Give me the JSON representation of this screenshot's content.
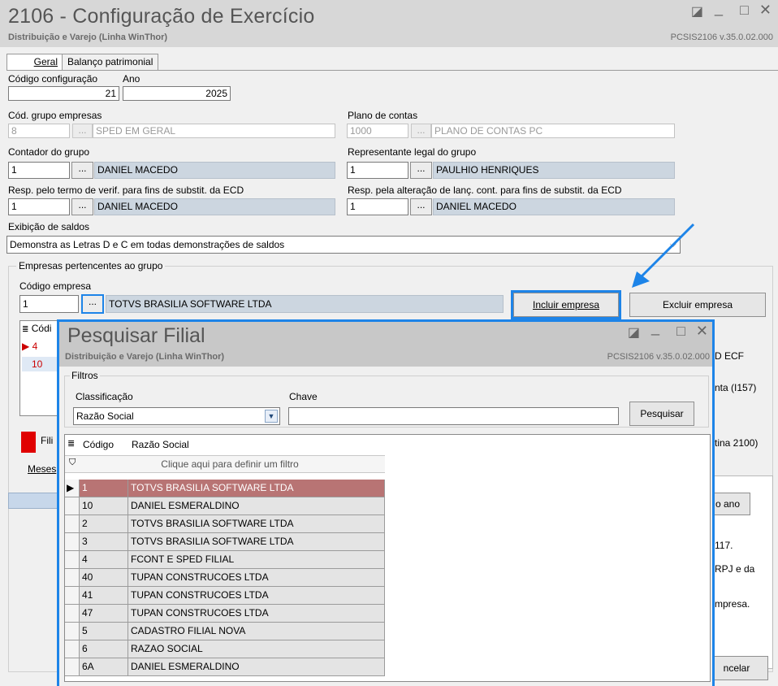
{
  "window": {
    "title": "2106 - Configuração de Exercício",
    "subtitle": "Distribuição e Varejo (Linha WinThor)",
    "version": "PCSIS2106  v.35.0.02.000",
    "btn_restore": "◪",
    "btn_min": "_",
    "btn_max": "□",
    "btn_close": "✕"
  },
  "tabs": [
    "Geral",
    "Balanço patrimonial"
  ],
  "form": {
    "codigo_config_label": "Código configuração",
    "codigo_config_value": "21",
    "ano_label": "Ano",
    "ano_value": "2025",
    "grupo_empresas_label": "Cód. grupo empresas",
    "grupo_empresas_code": "8",
    "grupo_empresas_name": "SPED EM GERAL",
    "plano_contas_label": "Plano de contas",
    "plano_contas_code": "1000",
    "plano_contas_name": "PLANO DE CONTAS PC",
    "contador_label": "Contador do grupo",
    "contador_code": "1",
    "contador_name": "DANIEL MACEDO",
    "representante_label": "Representante legal do grupo",
    "representante_code": "1",
    "representante_name": "PAULHIO HENRIQUES",
    "resp_verif_label": "Resp. pelo termo de verif. para fins de substit. da ECD",
    "resp_verif_code": "1",
    "resp_verif_name": "DANIEL MACEDO",
    "resp_alter_label": "Resp. pela alteração de lanç. cont. para fins de substit. da ECD",
    "resp_alter_code": "1",
    "resp_alter_name": "DANIEL MACEDO",
    "exibicao_label": "Exibição de saldos",
    "exibicao_value": "Demonstra as Letras D e C em todas demonstrações de saldos",
    "dots": "..."
  },
  "empresas": {
    "group_label": "Empresas pertencentes ao grupo",
    "codigo_label": "Código empresa",
    "codigo_value": "1",
    "nome_value": "TOTVS BRASILIA SOFTWARE LTDA",
    "incluir": "Incluir empresa",
    "excluir": "Excluir empresa",
    "grid_header": "Códi",
    "grid_rows": [
      "4",
      "10"
    ],
    "filial_label": "Fili",
    "meses_tab": "Meses"
  },
  "background_fragments": {
    "ecf": "D ECF",
    "conta": "nta (I157)",
    "rotina": "tina 2100)",
    "ano_btn": "o ano",
    "t117": "117.",
    "rpj": "RPJ e da",
    "empresa": "mpresa.",
    "cancelar": "ncelar"
  },
  "dialog": {
    "title": "Pesquisar Filial",
    "subtitle": "Distribuição e Varejo (Linha WinThor)",
    "version": "PCSIS2106  v.35.0.02.000",
    "filtros_label": "Filtros",
    "classificacao_label": "Classificação",
    "classificacao_value": "Razão Social",
    "chave_label": "Chave",
    "chave_value": "",
    "pesquisar": "Pesquisar",
    "col_codigo": "Código",
    "col_razao": "Razão Social",
    "filter_hint": "Clique aqui para definir um filtro",
    "rows": [
      {
        "code": "1",
        "name": "TOTVS BRASILIA SOFTWARE LTDA"
      },
      {
        "code": "10",
        "name": "DANIEL ESMERALDINO"
      },
      {
        "code": "2",
        "name": "TOTVS BRASILIA SOFTWARE LTDA"
      },
      {
        "code": "3",
        "name": "TOTVS BRASILIA SOFTWARE LTDA"
      },
      {
        "code": "4",
        "name": "FCONT E SPED FILIAL"
      },
      {
        "code": "40",
        "name": "TUPAN CONSTRUCOES LTDA"
      },
      {
        "code": "41",
        "name": "TUPAN CONSTRUCOES LTDA"
      },
      {
        "code": "47",
        "name": "TUPAN CONSTRUCOES LTDA"
      },
      {
        "code": "5",
        "name": "CADASTRO FILIAL NOVA"
      },
      {
        "code": "6",
        "name": "RAZAO SOCIAL"
      },
      {
        "code": "6A",
        "name": "DANIEL ESMERALDINO"
      }
    ],
    "selected_color": "#b87474"
  },
  "colors": {
    "highlight": "#1d84e8"
  }
}
